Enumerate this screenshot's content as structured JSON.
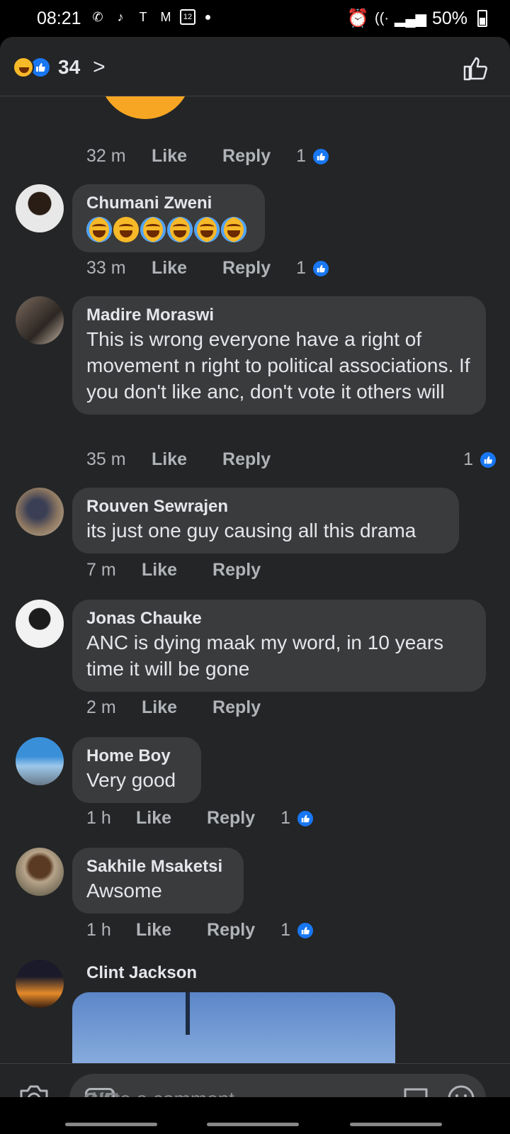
{
  "status_bar": {
    "time": "08:21",
    "calendar_day": "12",
    "battery": "50%"
  },
  "header": {
    "reaction_count": "34"
  },
  "comments": [
    {
      "name": "Chumani Zweni",
      "text": "",
      "time": "33 m",
      "like": "Like",
      "reply": "Reply",
      "likes": "1"
    },
    {
      "name": "Madire Moraswi",
      "text": "This is wrong everyone have a right of movement n right to political associations. If you don't like anc, don't vote it others will",
      "time": "35 m",
      "like": "Like",
      "reply": "Reply",
      "likes": "1"
    },
    {
      "name": "Rouven Sewrajen",
      "text": "its just one guy causing all this drama",
      "time": "7 m",
      "like": "Like",
      "reply": "Reply",
      "likes": ""
    },
    {
      "name": "Jonas Chauke",
      "text": "ANC is dying maak my word, in 10 years time it will be gone",
      "time": "2 m",
      "like": "Like",
      "reply": "Reply",
      "likes": ""
    },
    {
      "name": "Home Boy",
      "text": "Very good",
      "time": "1 h",
      "like": "Like",
      "reply": "Reply",
      "likes": "1"
    },
    {
      "name": "Sakhile Msaketsi",
      "text": "Awsome",
      "time": "1 h",
      "like": "Like",
      "reply": "Reply",
      "likes": "1"
    },
    {
      "name": "Clint Jackson",
      "text": ""
    }
  ],
  "previous_comment_actions": {
    "time": "32 m",
    "like": "Like",
    "reply": "Reply",
    "likes": "1"
  },
  "composer": {
    "placeholder": "Write a comment...",
    "gif_label": "GIF"
  },
  "colors": {
    "background": "#242526",
    "bubble": "#3a3b3c",
    "accent": "#1877f2",
    "muted_text": "#b0b3b8"
  }
}
